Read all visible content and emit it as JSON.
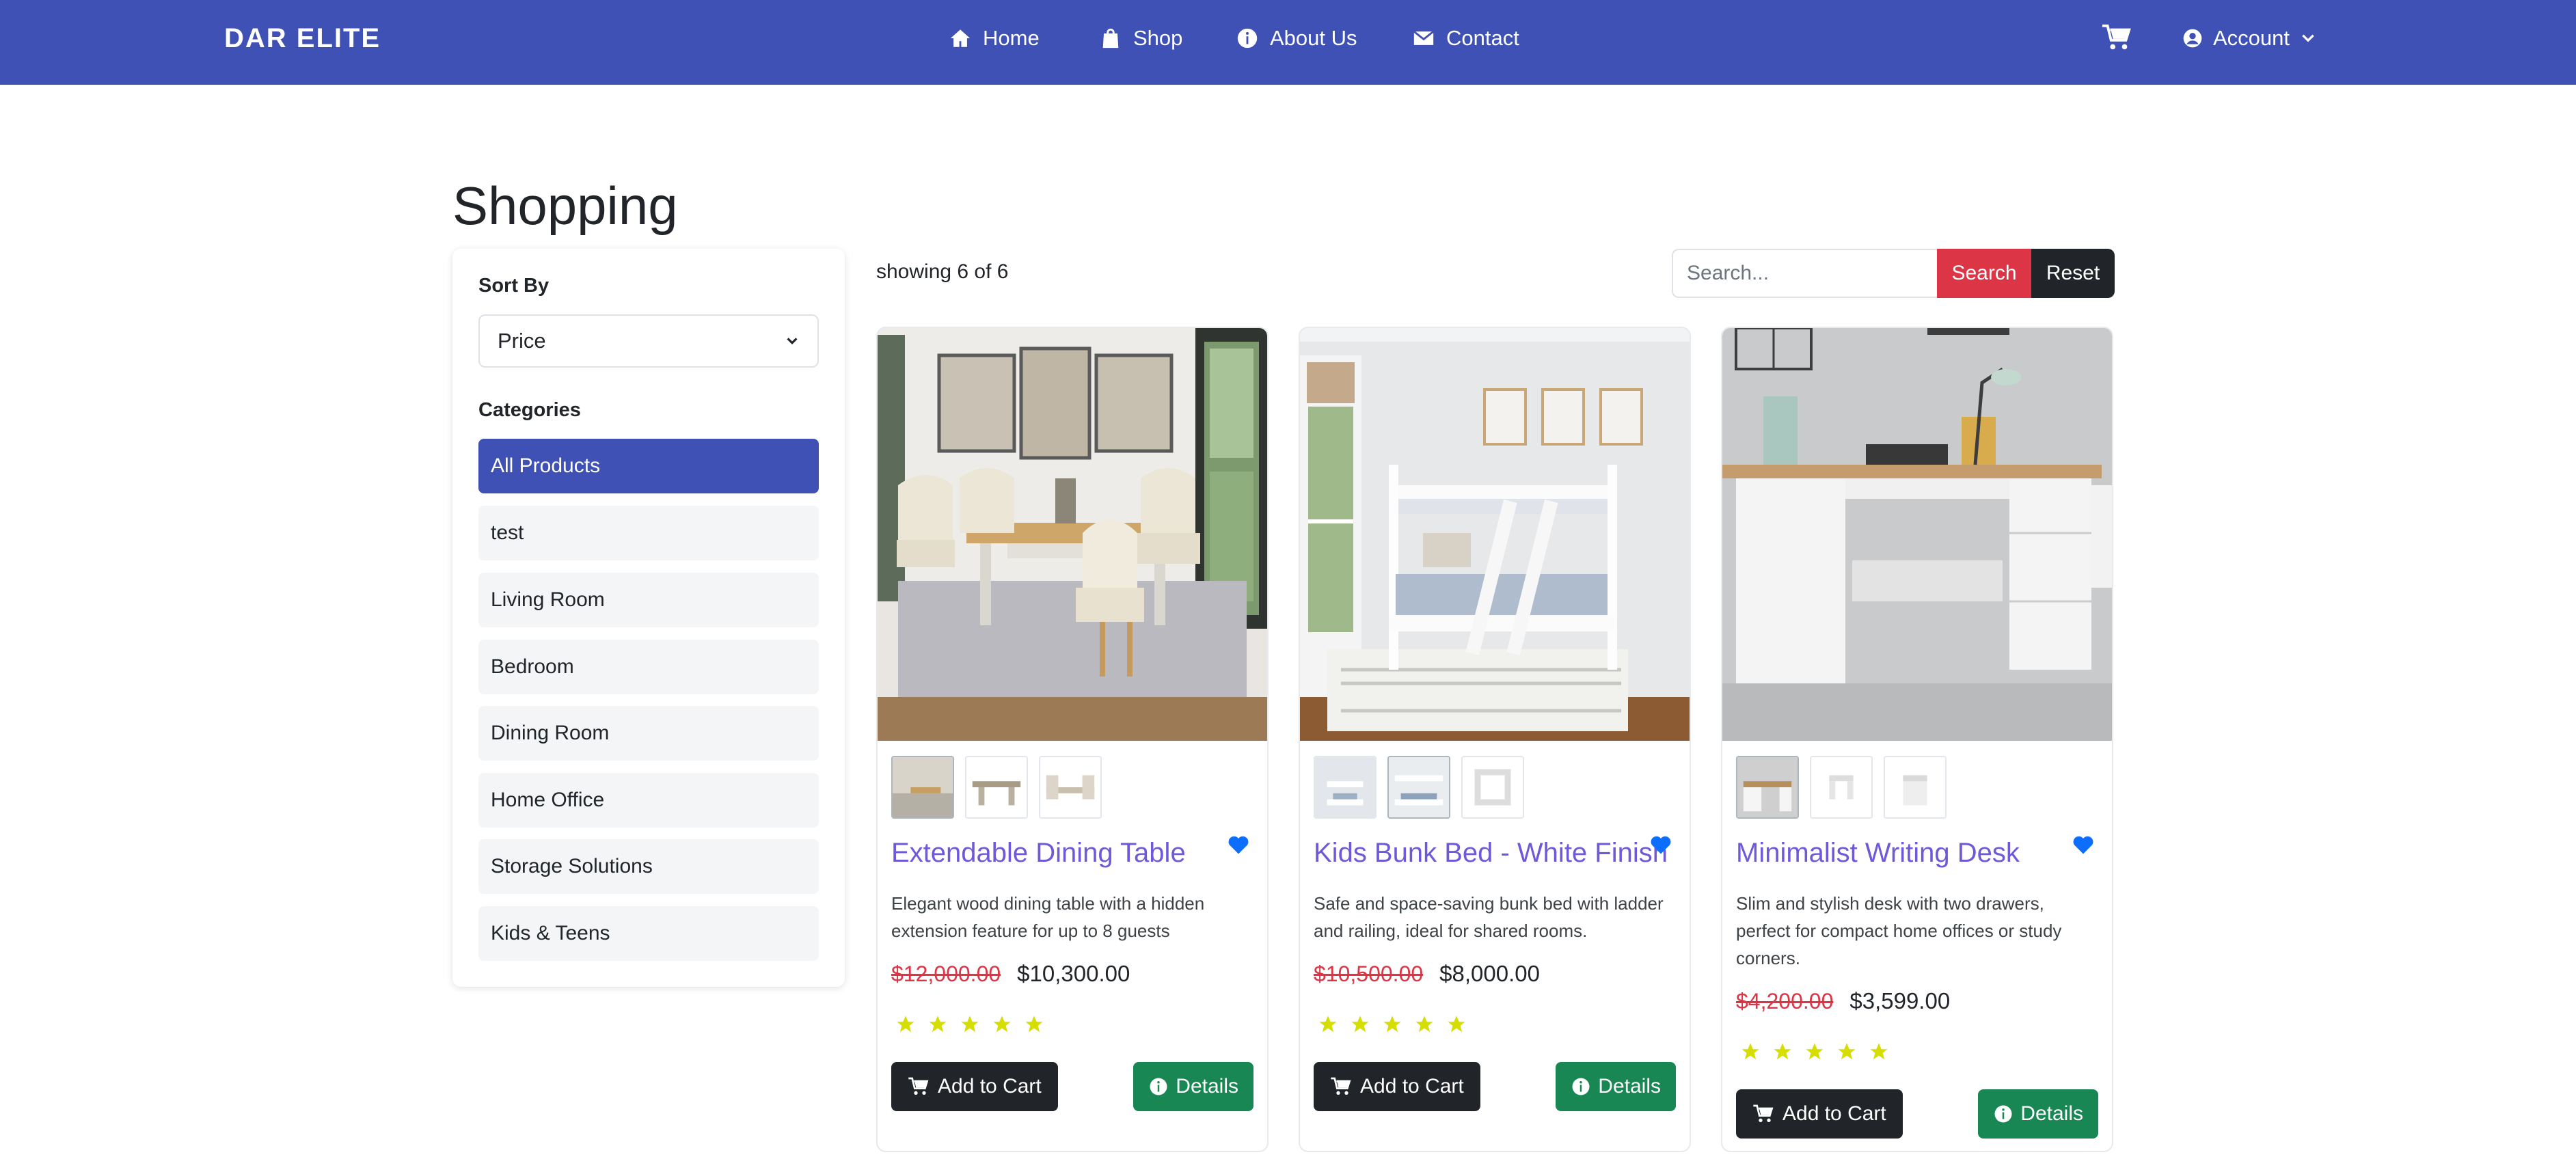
{
  "nav": {
    "brand": "DAR ELITE",
    "links": [
      {
        "label": "Home",
        "icon": "home-icon"
      },
      {
        "label": "Shop",
        "icon": "shopping-bag-icon"
      },
      {
        "label": "About Us",
        "icon": "info-icon"
      },
      {
        "label": "Contact",
        "icon": "envelope-icon"
      }
    ],
    "cart_icon": "cart-icon",
    "account_label": "Account"
  },
  "page": {
    "title": "Shopping"
  },
  "sidebar": {
    "sort_label": "Sort By",
    "sort_value": "Price",
    "categories_label": "Categories",
    "categories": [
      {
        "label": "All Products",
        "active": true
      },
      {
        "label": "test"
      },
      {
        "label": "Living Room"
      },
      {
        "label": "Bedroom"
      },
      {
        "label": "Dining Room"
      },
      {
        "label": "Home Office"
      },
      {
        "label": "Storage Solutions"
      },
      {
        "label": "Kids & Teens"
      }
    ]
  },
  "toolbar": {
    "showing": "showing 6 of 6",
    "search_placeholder": "Search...",
    "search_label": "Search",
    "reset_label": "Reset"
  },
  "products": [
    {
      "title": "Extendable Dining Table",
      "description": "Elegant wood dining table with a hidden extension feature for up to 8 guests",
      "old_price": "$12,000.00",
      "price": "$10,300.00",
      "rating": 5,
      "add_to_cart": "Add to Cart",
      "details": "Details"
    },
    {
      "title": "Kids Bunk Bed - White Finish",
      "description": "Safe and space-saving bunk bed with ladder and railing, ideal for shared rooms.",
      "old_price": "$10,500.00",
      "price": "$8,000.00",
      "rating": 5,
      "add_to_cart": "Add to Cart",
      "details": "Details"
    },
    {
      "title": "Minimalist Writing Desk",
      "description": "Slim and stylish desk with two drawers, perfect for compact home offices or study corners.",
      "old_price": "$4,200.00",
      "price": "$3,599.00",
      "rating": 5,
      "add_to_cart": "Add to Cart",
      "details": "Details"
    }
  ],
  "colors": {
    "primary": "#3f51b5",
    "danger": "#dc3545",
    "dark": "#212529",
    "success": "#198754",
    "title_link": "#6f59d9",
    "star": "#d6dd00",
    "heart": "#0d6efd"
  }
}
